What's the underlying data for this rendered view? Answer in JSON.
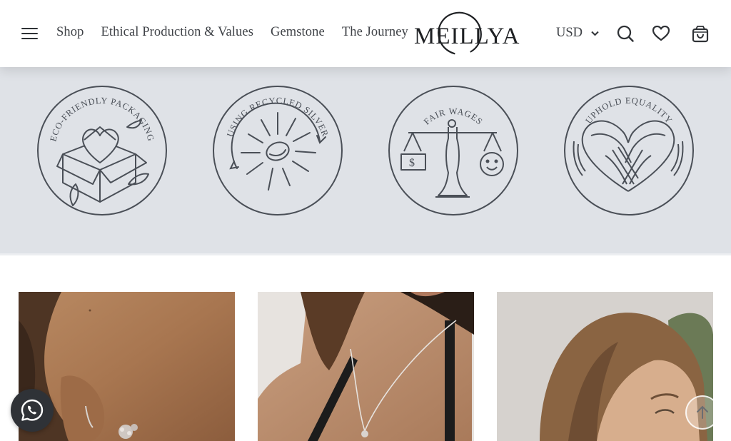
{
  "header": {
    "nav": [
      {
        "label": "Shop"
      },
      {
        "label": "Ethical Production & Values"
      },
      {
        "label": "Gemstone"
      },
      {
        "label": "The Journey"
      }
    ],
    "logo": "MEILLYA",
    "currency": "USD",
    "icons": [
      "menu-icon",
      "search-icon",
      "heart-icon",
      "bag-icon"
    ]
  },
  "values": {
    "badges": [
      {
        "caption": "ECO-FRIENDLY PACKAGING",
        "icon": "gift-box-heart-icon"
      },
      {
        "caption": "USING RECYCLED SILVER",
        "icon": "recycled-silver-icon"
      },
      {
        "caption": "FAIR WAGES",
        "icon": "scales-icon"
      },
      {
        "caption": "UPHOLD EQUALITY",
        "icon": "hands-heart-icon"
      }
    ],
    "background": "#dfe2e7",
    "line_color": "#4a4f57"
  },
  "products": [
    {
      "image": "earring-model-photo"
    },
    {
      "image": "necklace-model-photo"
    },
    {
      "image": "woman-portrait-photo"
    }
  ],
  "floating": {
    "whatsapp": "whatsapp-icon",
    "back_to_top": "arrow-up-icon"
  }
}
